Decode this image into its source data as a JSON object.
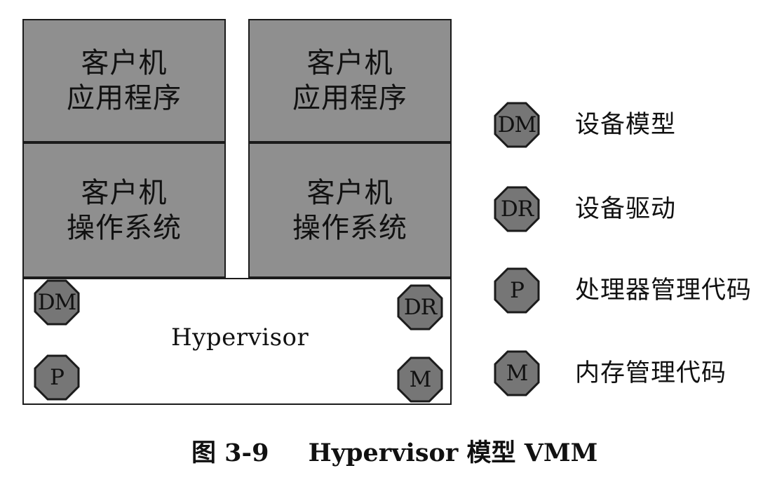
{
  "diagram": {
    "boxes": {
      "left_app": "客户机\n应用程序",
      "right_app": "客户机\n应用程序",
      "left_os": "客户机\n操作系统",
      "right_os": "客户机\n操作系统"
    },
    "hypervisor": {
      "label": "Hypervisor",
      "modules": {
        "dm": "DM",
        "dr": "DR",
        "p": "P",
        "m": "M"
      }
    }
  },
  "legend": [
    {
      "symbol": "DM",
      "label": "设备模型"
    },
    {
      "symbol": "DR",
      "label": "设备驱动"
    },
    {
      "symbol": "P",
      "label": "处理器管理代码"
    },
    {
      "symbol": "M",
      "label": "内存管理代码"
    }
  ],
  "caption": {
    "figure": "图 3-9",
    "title": "Hypervisor 模型 VMM"
  },
  "colors": {
    "box_fill": "#8f8f8f",
    "octagon_fill": "#767676",
    "stroke": "#1b1b1b",
    "background": "#ffffff"
  }
}
